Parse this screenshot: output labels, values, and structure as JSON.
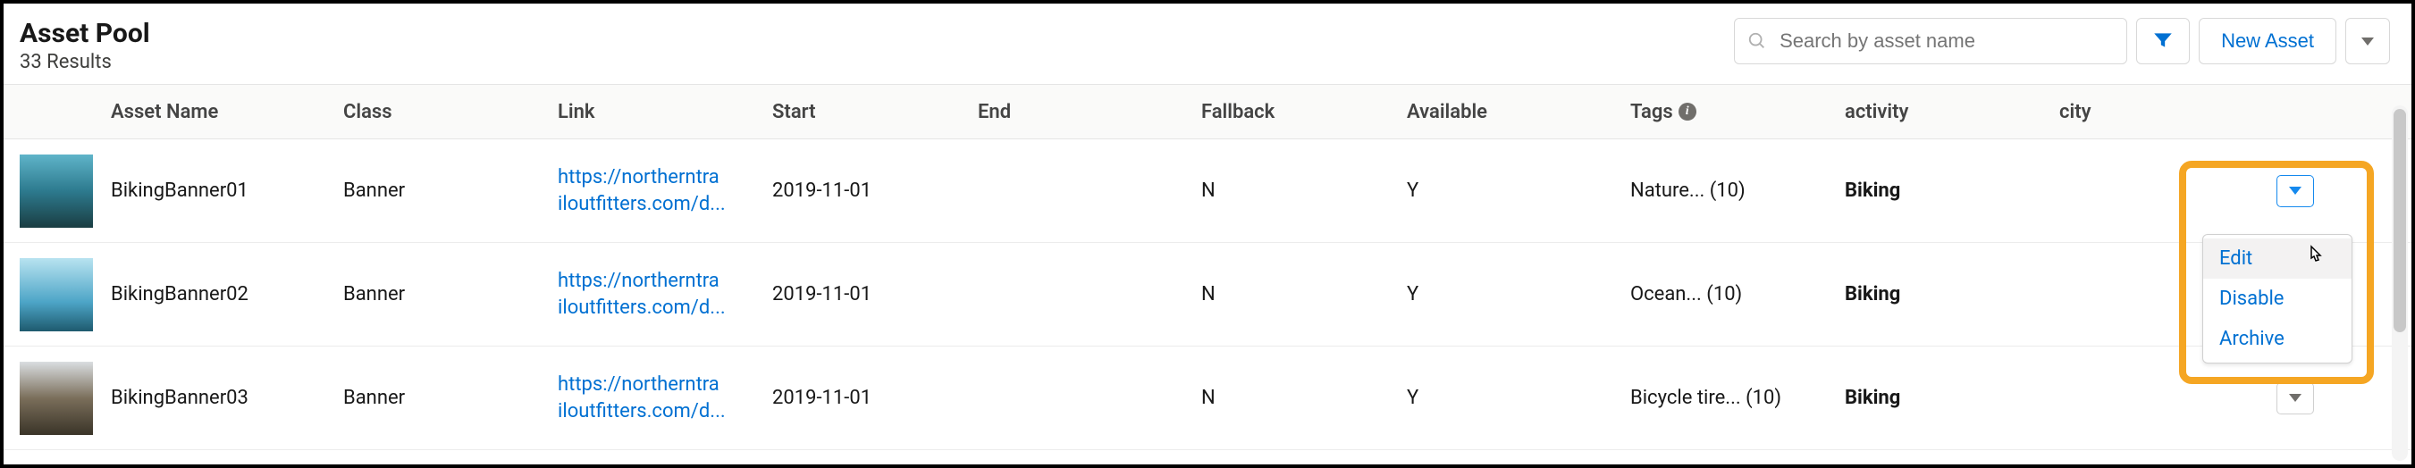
{
  "header": {
    "title": "Asset Pool",
    "results": "33 Results",
    "search_placeholder": "Search by asset name",
    "new_asset_label": "New Asset"
  },
  "columns": {
    "name": "Asset Name",
    "class": "Class",
    "link": "Link",
    "start": "Start",
    "end": "End",
    "fallback": "Fallback",
    "available": "Available",
    "tags": "Tags",
    "activity": "activity",
    "city": "city"
  },
  "rows": [
    {
      "name": "BikingBanner01",
      "class": "Banner",
      "link_line1": "https://northerntra",
      "link_line2": "iloutfitters.com/d...",
      "start": "2019-11-01",
      "end": "",
      "fallback": "N",
      "available": "Y",
      "tags": "Nature... (10)",
      "activity": "Biking",
      "city": ""
    },
    {
      "name": "BikingBanner02",
      "class": "Banner",
      "link_line1": "https://northerntra",
      "link_line2": "iloutfitters.com/d...",
      "start": "2019-11-01",
      "end": "",
      "fallback": "N",
      "available": "Y",
      "tags": "Ocean... (10)",
      "activity": "Biking",
      "city": ""
    },
    {
      "name": "BikingBanner03",
      "class": "Banner",
      "link_line1": "https://northerntra",
      "link_line2": "iloutfitters.com/d...",
      "start": "2019-11-01",
      "end": "",
      "fallback": "N",
      "available": "Y",
      "tags": "Bicycle tire... (10)",
      "activity": "Biking",
      "city": ""
    }
  ],
  "dropdown": {
    "edit": "Edit",
    "disable": "Disable",
    "archive": "Archive"
  }
}
